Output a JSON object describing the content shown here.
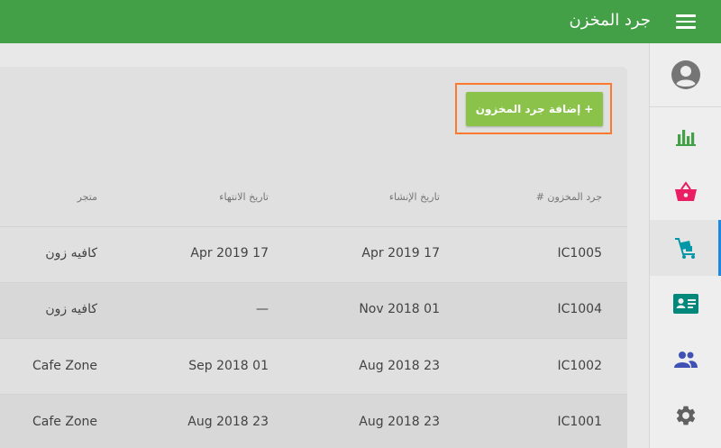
{
  "header": {
    "title": "جرد المخزن"
  },
  "actions": {
    "add_label": "إضافة جرد المخزون",
    "add_plus": "+"
  },
  "table": {
    "columns": [
      "جرد المخزون #",
      "تاريخ الإنشاء",
      "تاريخ الانتهاء",
      "متجر"
    ],
    "rows": [
      {
        "id": "IC1005",
        "created": "17 Apr 2019",
        "ends": "17 Apr 2019",
        "store": "كافيه زون"
      },
      {
        "id": "IC1004",
        "created": "01 Nov 2018",
        "ends": "—",
        "store": "كافيه زون"
      },
      {
        "id": "IC1002",
        "created": "23 Aug 2018",
        "ends": "01 Sep 2018",
        "store": "Cafe Zone"
      },
      {
        "id": "IC1001",
        "created": "23 Aug 2018",
        "ends": "23 Aug 2018",
        "store": "Cafe Zone"
      }
    ]
  },
  "sidebar": {
    "icons": [
      "account-icon",
      "chart-icon",
      "basket-icon",
      "cart-icon",
      "id-card-icon",
      "users-icon",
      "gear-icon"
    ]
  },
  "colors": {
    "primary": "#43a047",
    "accent_button": "#8bc34a",
    "highlight": "#ff7a2f",
    "active_indicator": "#1e88e5"
  }
}
